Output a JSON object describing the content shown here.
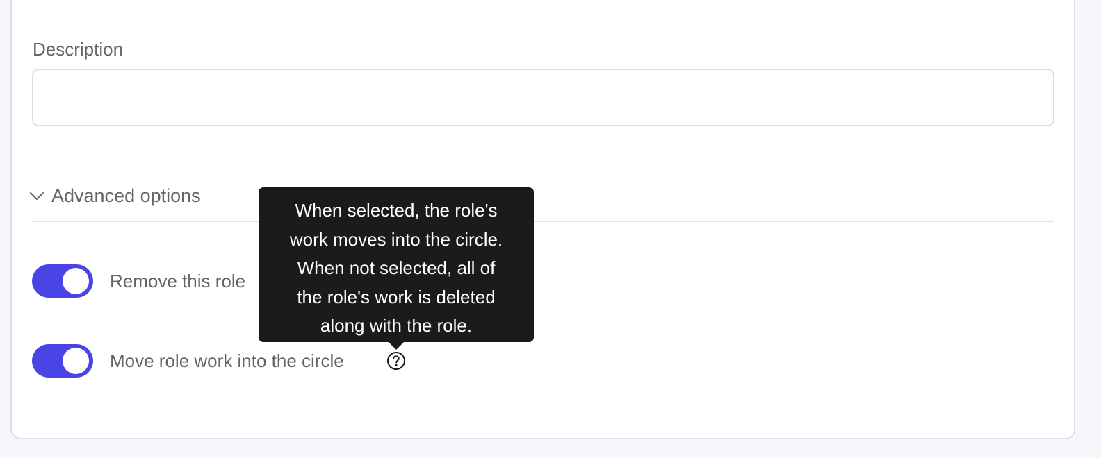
{
  "form": {
    "description_label": "Description",
    "description_value": "",
    "description_placeholder": ""
  },
  "advanced": {
    "label": "Advanced options",
    "expanded": true,
    "icon": "chevron-down-icon"
  },
  "options": [
    {
      "label": "Remove this role",
      "enabled": true
    },
    {
      "label": "Move role work into the circle",
      "enabled": true,
      "help_icon": "question-circle-icon"
    }
  ],
  "tooltip": {
    "lines": [
      "When selected, the role's",
      "work moves into the circle.",
      "When not selected, all of",
      "the role's work is deleted",
      "along with the role."
    ]
  },
  "colors": {
    "accent": "#4a43e6",
    "tooltip_bg": "#1b1b1b",
    "label_text": "#646469",
    "border": "#dcdce2"
  }
}
